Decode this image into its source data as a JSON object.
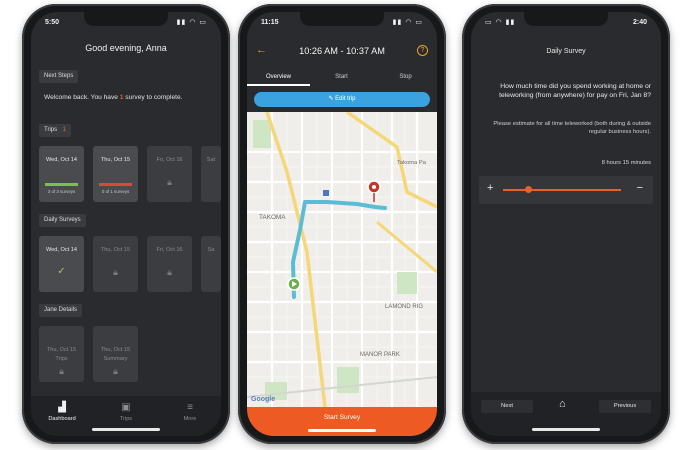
{
  "phone1": {
    "status_time": "5:50",
    "greeting": "Good evening, Anna",
    "next_steps_label": "Next Steps",
    "welcome_before": "Welcome back. You have ",
    "welcome_count": "1",
    "welcome_after": " survey to complete.",
    "trips_label": "Trips",
    "trips_count": "1",
    "trip_cards": [
      {
        "date": "Wed, Oct 14",
        "sub": "3 of 3 surveys",
        "progress": 1.0,
        "color": "#7fbf4d"
      },
      {
        "date": "Thu, Oct 15",
        "sub": "0 of 1 surveys",
        "progress": 0.0,
        "color": "#e64a3b"
      },
      {
        "date": "Fri, Oct 16"
      },
      {
        "date": "Sat"
      }
    ],
    "daily_label": "Daily Surveys",
    "daily_cards": [
      {
        "date": "Wed, Oct 14"
      },
      {
        "date": "Thu, Oct 15"
      },
      {
        "date": "Fri, Oct 16"
      },
      {
        "date": "Sa"
      }
    ],
    "details_label": "Jane Details",
    "detail_cards": [
      {
        "line1": "Thu, Oct 15",
        "line2": "Trips"
      },
      {
        "line1": "Thu, Oct 15",
        "line2": "Summary"
      }
    ],
    "tabs": [
      {
        "label": "Dashboard",
        "icon": "bar-chart-icon"
      },
      {
        "label": "Trips",
        "icon": "map-icon"
      },
      {
        "label": "More",
        "icon": "menu-icon"
      }
    ]
  },
  "phone2": {
    "status_time": "11:15",
    "title": "10:26 AM - 10:37 AM",
    "help": "?",
    "tabs": [
      "Overview",
      "Start",
      "Stop"
    ],
    "edit_label": "Edit trip",
    "map_labels": {
      "takoma": "TAKOMA",
      "takoma_park": "Takoma Pa",
      "lamond": "LAMOND RIG",
      "manor": "MANOR PARK",
      "google": "Google"
    },
    "cta": "Start Survey"
  },
  "phone3": {
    "status_time": "2:40",
    "title": "Daily Survey",
    "question": "How much time did you spend working at home or teleworking (from anywhere) for pay on Fri, Jan 8?",
    "note": "Please estimate for all time teleworked (both during & outside regular business hours).",
    "value": "8 hours 15 minutes",
    "plus": "+",
    "minus": "−",
    "next": "Next",
    "previous": "Previous"
  },
  "colors": {
    "accent_orange": "#ee5a23",
    "trip_blue": "#3aa2de",
    "route_blue": "#5bbcd6",
    "success_green": "#7fbf4d"
  }
}
